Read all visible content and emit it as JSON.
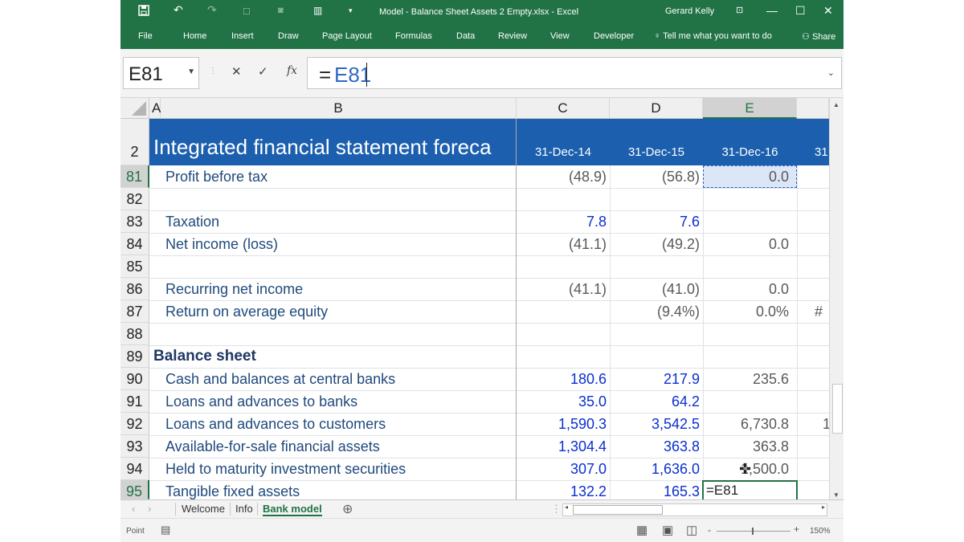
{
  "window": {
    "title": "Model - Balance Sheet Assets 2 Empty.xlsx  -  Excel",
    "user": "Gerard Kelly",
    "minimize": "—",
    "restore": "☐",
    "close": "✕",
    "accent_color": "#217346"
  },
  "quick_access": {
    "save_icon": "save-icon",
    "undo_icon": "undo-icon",
    "redo_icon": "redo-icon",
    "more": "▾"
  },
  "ribbon": {
    "tabs": [
      "File",
      "Home",
      "Insert",
      "Draw",
      "Page Layout",
      "Formulas",
      "Data",
      "Review",
      "View",
      "Developer"
    ],
    "tell_me": "Tell me what you want to do",
    "share": "Share"
  },
  "formula_bar": {
    "name_box": "E81",
    "cancel": "✕",
    "enter": "✓",
    "fx": "fx",
    "formula_eq": "=",
    "formula_ref": "E81"
  },
  "columns": [
    "A",
    "B",
    "C",
    "D",
    "E"
  ],
  "header_row": {
    "row_number": "2",
    "title": "Integrated financial statement foreca",
    "dates": [
      "31-Dec-14",
      "31-Dec-15",
      "31-Dec-16",
      "31"
    ]
  },
  "rows": [
    {
      "num": "81",
      "label": "Profit before tax",
      "c": "(48.9)",
      "d": "(56.8)",
      "e": "0.0",
      "f": ""
    },
    {
      "num": "82",
      "label": "",
      "c": "",
      "d": "",
      "e": "",
      "f": ""
    },
    {
      "num": "83",
      "label": "Taxation",
      "c": "7.8",
      "d": "7.6",
      "e": "",
      "f": ""
    },
    {
      "num": "84",
      "label": "Net income (loss)",
      "c": "(41.1)",
      "d": "(49.2)",
      "e": "0.0",
      "f": ""
    },
    {
      "num": "85",
      "label": "",
      "c": "",
      "d": "",
      "e": "",
      "f": ""
    },
    {
      "num": "86",
      "label": "Recurring net income",
      "c": "(41.1)",
      "d": "(41.0)",
      "e": "0.0",
      "f": ""
    },
    {
      "num": "87",
      "label": "Return on average equity",
      "c": "",
      "d": "(9.4%)",
      "e": "0.0%",
      "f": "#"
    },
    {
      "num": "88",
      "label": "",
      "c": "",
      "d": "",
      "e": "",
      "f": ""
    },
    {
      "num": "89",
      "label": "Balance sheet",
      "c": "",
      "d": "",
      "e": "",
      "f": ""
    },
    {
      "num": "90",
      "label": "Cash and balances at central banks",
      "c": "180.6",
      "d": "217.9",
      "e": "235.6",
      "f": ""
    },
    {
      "num": "91",
      "label": "Loans and advances to banks",
      "c": "35.0",
      "d": "64.2",
      "e": "",
      "f": ""
    },
    {
      "num": "92",
      "label": "Loans and advances to customers",
      "c": "1,590.3",
      "d": "3,542.5",
      "e": "6,730.8",
      "f": "1"
    },
    {
      "num": "93",
      "label": "Available-for-sale financial assets",
      "c": "1,304.4",
      "d": "363.8",
      "e": "363.8",
      "f": ""
    },
    {
      "num": "94",
      "label": "Held to maturity investment securities",
      "c": "307.0",
      "d": "1,636.0",
      "e": "1,500.0",
      "f": ""
    },
    {
      "num": "95",
      "label": "Tangible fixed assets",
      "c": "132.2",
      "d": "165.3",
      "e": "=E81",
      "f": ""
    }
  ],
  "sheet_tabs": [
    "Welcome",
    "Info",
    "Bank model"
  ],
  "status": {
    "mode": "Point",
    "zoom": "150%"
  }
}
